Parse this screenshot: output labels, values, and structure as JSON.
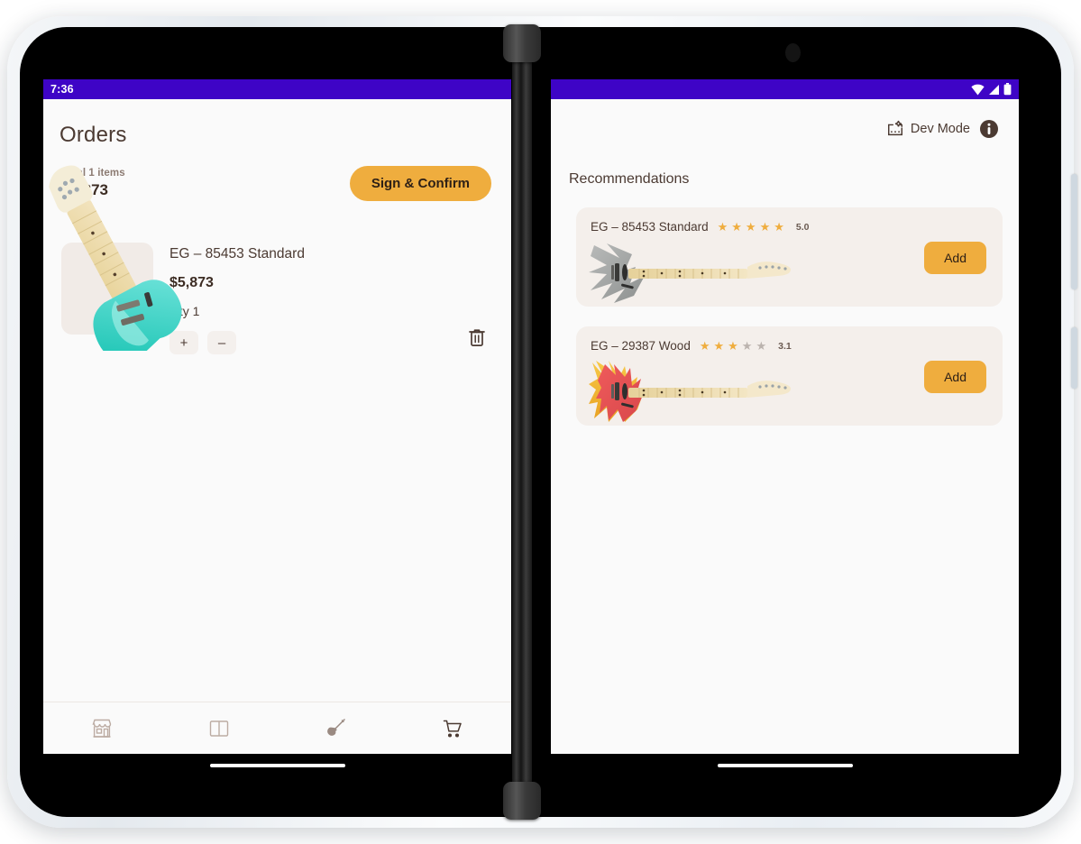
{
  "device": {
    "type": "foldable-tablet",
    "frame_color": "#eef1f4",
    "bezel_color": "#000000",
    "hinge_color": "#2f2f2f"
  },
  "status_bar": {
    "clock": "7:36",
    "background": "#3E04C6",
    "icons": [
      "wifi-icon",
      "signal-icon",
      "battery-icon"
    ]
  },
  "left_screen": {
    "page_title": "Orders",
    "summary": {
      "total_label": "Total 1 items",
      "total_amount": "$5,873",
      "confirm_button": "Sign & Confirm",
      "accent": "#EFAD3E"
    },
    "cart_items": [
      {
        "name": "EG – 85453 Standard",
        "price": "$5,873",
        "qty_label": "Qty 1",
        "increase_label": "+",
        "decrease_label": "–",
        "delete_icon": "trash-icon",
        "image": "electric-guitar-teal"
      }
    ],
    "bottom_nav": [
      {
        "icon": "storefront-icon",
        "active": false
      },
      {
        "icon": "catalog-book-icon",
        "active": false
      },
      {
        "icon": "guitar-icon",
        "active": false
      },
      {
        "icon": "shopping-cart-icon",
        "active": true
      }
    ]
  },
  "right_screen": {
    "dev_mode": {
      "label": "Dev Mode",
      "icon": "dev-mode-icon"
    },
    "info_icon": "info-icon",
    "section_title": "Recommendations",
    "recommendations": [
      {
        "name": "EG – 85453 Standard",
        "rating": "5.0",
        "stars_filled": 5,
        "stars_total": 5,
        "add_label": "Add",
        "image": "electric-guitar-silver"
      },
      {
        "name": "EG – 29387 Wood",
        "rating": "3.1",
        "stars_filled": 3,
        "stars_total": 5,
        "add_label": "Add",
        "image": "electric-guitar-red-flame"
      }
    ]
  },
  "colors": {
    "accent": "#EFAD3E",
    "text": "#4B3A32",
    "muted": "#8C7B72",
    "card_bg": "#F4EFEB",
    "screen_bg": "#FAFAFA",
    "status_bar": "#3E04C6"
  }
}
